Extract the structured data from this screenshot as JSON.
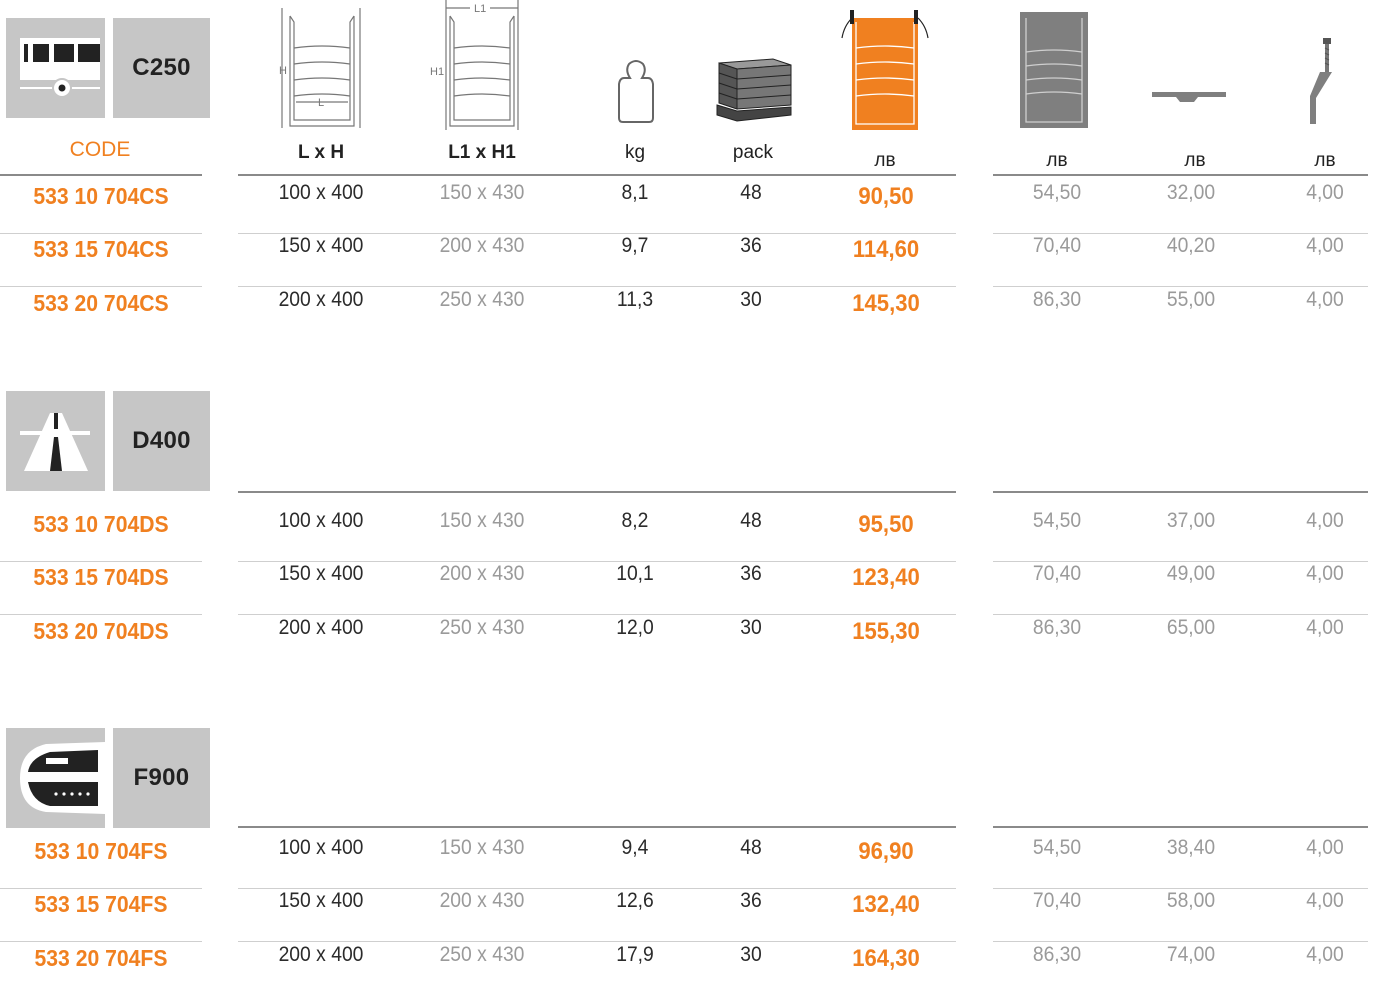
{
  "header": {
    "code": "CODE",
    "lxh": "L x H",
    "l1xh1": "L1 x H1",
    "kg": "kg",
    "pack": "pack",
    "currency": "лв",
    "dim_h": "H",
    "dim_l": "L",
    "dim_h1": "H1",
    "dim_l1": "L1"
  },
  "colors": {
    "accent": "#f08020",
    "panel": "#c6c6c6",
    "rule": "#8a8a8a"
  },
  "icons": [
    "pedestrian-traffic-icon",
    "road-traffic-icon",
    "aircraft-icon",
    "channel-dimension-icon",
    "channel-outer-dimension-icon",
    "weight-icon",
    "pallet-icon",
    "orange-channel-icon",
    "gray-channel-icon",
    "grate-icon",
    "bolt-icon"
  ],
  "sections": [
    {
      "class": "C250",
      "rows": [
        {
          "code": "533 10 704CS",
          "lxh": "100 x 400",
          "l1xh1": "150 x 430",
          "kg": "8,1",
          "pack": "48",
          "price": "90,50",
          "p1": "54,50",
          "p2": "32,00",
          "p3": "4,00"
        },
        {
          "code": "533 15 704CS",
          "lxh": "150 x 400",
          "l1xh1": "200 x 430",
          "kg": "9,7",
          "pack": "36",
          "price": "114,60",
          "p1": "70,40",
          "p2": "40,20",
          "p3": "4,00"
        },
        {
          "code": "533 20 704CS",
          "lxh": "200 x 400",
          "l1xh1": "250 x 430",
          "kg": "11,3",
          "pack": "30",
          "price": "145,30",
          "p1": "86,30",
          "p2": "55,00",
          "p3": "4,00"
        }
      ]
    },
    {
      "class": "D400",
      "rows": [
        {
          "code": "533 10 704DS",
          "lxh": "100 x 400",
          "l1xh1": "150 x 430",
          "kg": "8,2",
          "pack": "48",
          "price": "95,50",
          "p1": "54,50",
          "p2": "37,00",
          "p3": "4,00"
        },
        {
          "code": "533 15 704DS",
          "lxh": "150 x 400",
          "l1xh1": "200 x 430",
          "kg": "10,1",
          "pack": "36",
          "price": "123,40",
          "p1": "70,40",
          "p2": "49,00",
          "p3": "4,00"
        },
        {
          "code": "533 20 704DS",
          "lxh": "200 x 400",
          "l1xh1": "250 x 430",
          "kg": "12,0",
          "pack": "30",
          "price": "155,30",
          "p1": "86,30",
          "p2": "65,00",
          "p3": "4,00"
        }
      ]
    },
    {
      "class": "F900",
      "rows": [
        {
          "code": "533 10 704FS",
          "lxh": "100 x 400",
          "l1xh1": "150 x 430",
          "kg": "9,4",
          "pack": "48",
          "price": "96,90",
          "p1": "54,50",
          "p2": "38,40",
          "p3": "4,00"
        },
        {
          "code": "533 15 704FS",
          "lxh": "150 x 400",
          "l1xh1": "200 x 430",
          "kg": "12,6",
          "pack": "36",
          "price": "132,40",
          "p1": "70,40",
          "p2": "58,00",
          "p3": "4,00"
        },
        {
          "code": "533 20 704FS",
          "lxh": "200 x 400",
          "l1xh1": "250 x 430",
          "kg": "17,9",
          "pack": "30",
          "price": "164,30",
          "p1": "86,30",
          "p2": "74,00",
          "p3": "4,00"
        }
      ]
    }
  ]
}
